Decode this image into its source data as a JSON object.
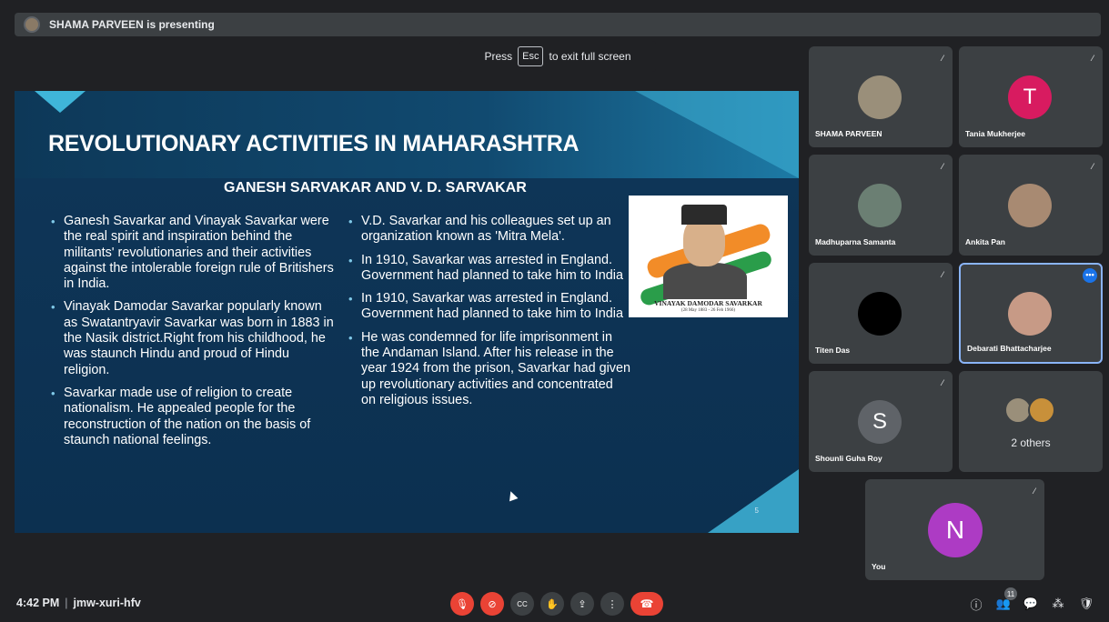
{
  "presenting_bar": {
    "text": "SHAMA PARVEEN is presenting"
  },
  "fullscreen_toast": {
    "before": "Press",
    "key": "Esc",
    "after": "to exit full screen"
  },
  "slide": {
    "title": "REVOLUTIONARY ACTIVITIES IN MAHARASHTRA",
    "subtitle": "GANESH SARVAKAR AND V. D. SARVAKAR",
    "left_bullets": [
      "Ganesh Savarkar and Vinayak Savarkar were the real spirit and inspiration behind the militants' revolutionaries and their activities against the intolerable foreign rule of Britishers in India.",
      "Vinayak Damodar Savarkar popularly known as Swatantryavir Savarkar was born in 1883 in the Nasik district.Right from his childhood, he was staunch Hindu and proud of Hindu religion.",
      "Savarkar made use of religion to create nationalism. He appealed people for the reconstruction of the nation on the basis of staunch national feelings."
    ],
    "mid_bullets": [
      "V.D. Savarkar and his colleagues set up an organization known as 'Mitra Mela'.",
      "In 1910, Savarkar was arrested in England. Government had planned to take him to India",
      "In 1910, Savarkar was arrested in England. Government had planned to take him to India",
      " He was condemned for life imprisonment in the Andaman Island. After his release in the year 1924 from the prison, Savarkar had given up revolutionary activities and concentrated on religious issues."
    ],
    "portrait_caption": "VINAYAK DAMODAR SAVARKAR",
    "portrait_dates": "(28 May 1883 - 26 Feb 1966)",
    "page_number": "5"
  },
  "participants": [
    {
      "name": "SHAMA PARVEEN",
      "avatar_color": "#9a8f7a",
      "muted": true
    },
    {
      "name": "Tania Mukherjee",
      "avatar_letter": "T",
      "avatar_color": "#d81b60",
      "muted": true
    },
    {
      "name": "Madhuparna Samanta",
      "avatar_color": "#6b7f73",
      "muted": true
    },
    {
      "name": "Ankita Pan",
      "avatar_color": "#a88a72",
      "muted": true
    },
    {
      "name": "Titen Das",
      "avatar_color": "#000000",
      "muted": true
    },
    {
      "name": "Debarati Bhattacharjee",
      "avatar_color": "#c79a86",
      "muted": false,
      "active": true
    },
    {
      "name": "Shounli Guha Roy",
      "avatar_letter": "S",
      "avatar_color": "#5f6368",
      "muted": true
    },
    {
      "name": "You",
      "avatar_letter": "N",
      "avatar_color": "#ad3bc4",
      "muted": true
    }
  ],
  "others_tile": {
    "label": "2 others"
  },
  "bottom_bar": {
    "time": "4:42 PM",
    "separator": "|",
    "meeting_code": "jmw-xuri-hfv",
    "people_count": "11"
  },
  "icons": {
    "mic_off": "🎙",
    "cam_off": "⊘",
    "captions": "CC",
    "raise_hand": "✋",
    "present": "⇪",
    "more": "⋮",
    "hangup": "☎",
    "info": "ⓘ",
    "people": "👥",
    "chat": "💬",
    "activities": "⁂",
    "host": "🛡",
    "dots": "•••",
    "mic_muted_small": "⁄"
  }
}
